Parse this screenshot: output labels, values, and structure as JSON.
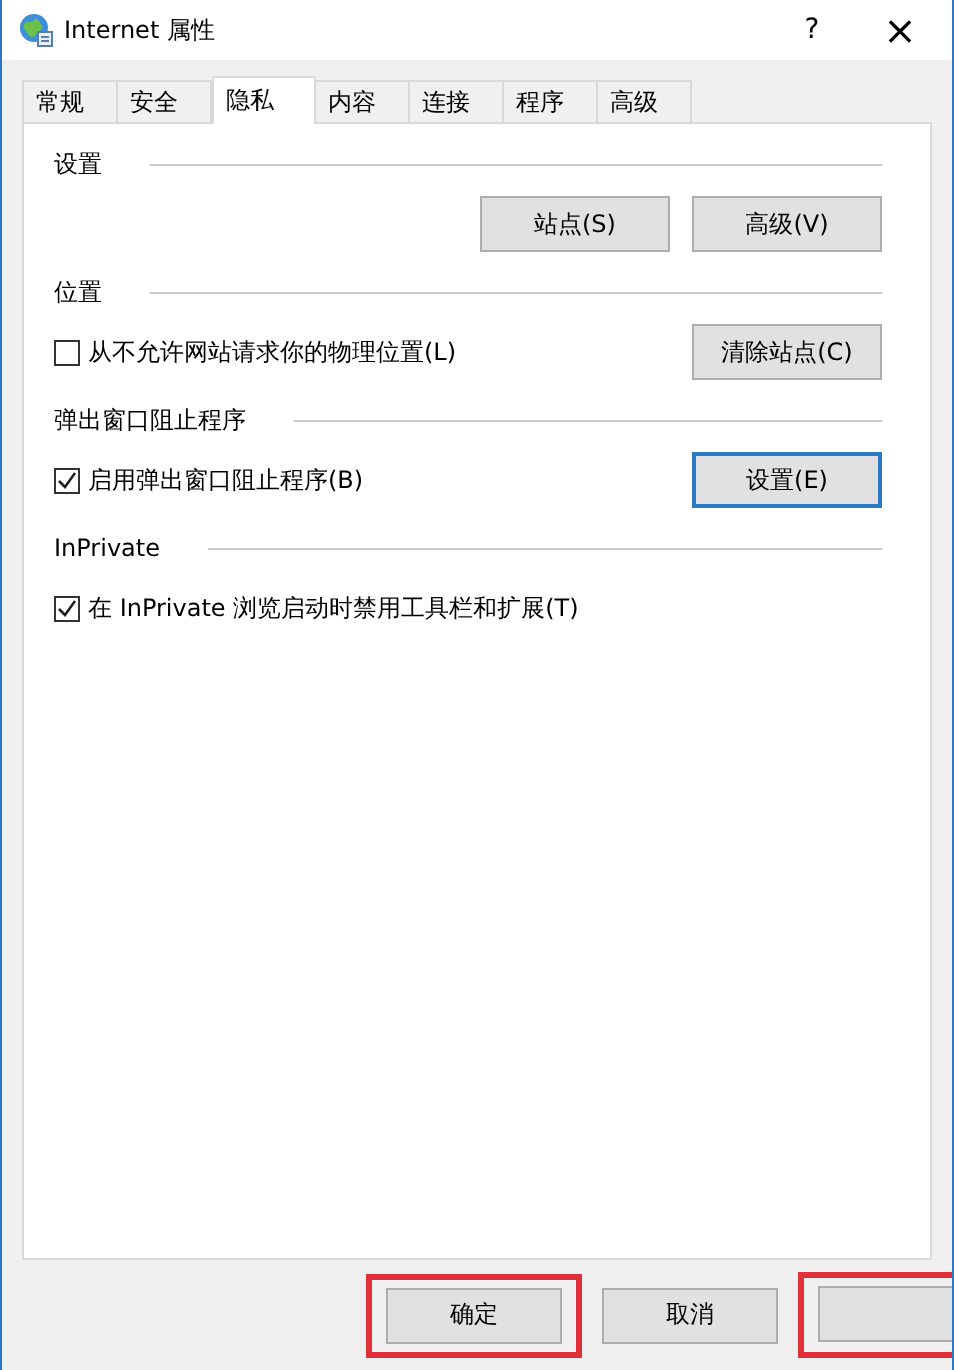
{
  "window": {
    "title": "Internet 属性",
    "help": "?",
    "close": "×"
  },
  "tabs": [
    {
      "label": "常规",
      "selected": false
    },
    {
      "label": "安全",
      "selected": false
    },
    {
      "label": "隐私",
      "selected": true
    },
    {
      "label": "内容",
      "selected": false
    },
    {
      "label": "连接",
      "selected": false
    },
    {
      "label": "程序",
      "selected": false
    },
    {
      "label": "高级",
      "selected": false
    }
  ],
  "sections": [
    {
      "title": "设置",
      "rows": [
        {
          "buttons": [
            {
              "label": "站点(S)",
              "focused": false
            },
            {
              "label": "高级(V)",
              "focused": false
            }
          ]
        }
      ]
    },
    {
      "title": "位置",
      "rows": [
        {
          "checkbox": {
            "label": "从不允许网站请求你的物理位置(L)",
            "checked": false
          },
          "buttons": [
            {
              "label": "清除站点(C)",
              "focused": false
            }
          ]
        }
      ]
    },
    {
      "title": "弹出窗口阻止程序",
      "rows": [
        {
          "checkbox": {
            "label": "启用弹出窗口阻止程序(B)",
            "checked": true
          },
          "buttons": [
            {
              "label": "设置(E)",
              "focused": true
            }
          ]
        }
      ]
    },
    {
      "title": "InPrivate",
      "rows": [
        {
          "checkbox": {
            "label": "在 InPrivate 浏览启动时禁用工具栏和扩展(T)",
            "checked": true
          }
        }
      ]
    }
  ],
  "footer_buttons": [
    {
      "label": "确定",
      "highlighted": true
    },
    {
      "label": "取消",
      "highlighted": false
    },
    {
      "highlighted": true
    }
  ]
}
